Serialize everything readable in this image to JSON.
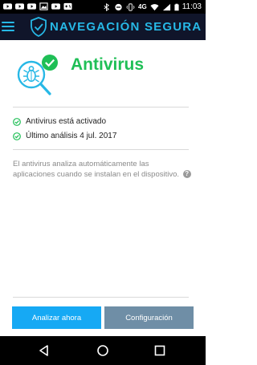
{
  "status_bar": {
    "time": "11:03",
    "network": "4G",
    "left_icons": [
      "youtube-icon",
      "youtube-icon",
      "youtube-icon",
      "image-icon",
      "youtube-icon",
      "gamepad-icon"
    ],
    "right_icons": [
      "bluetooth-icon",
      "minus-circle-icon",
      "vibrate-icon",
      "wifi-icon",
      "signal-icon",
      "battery-icon"
    ]
  },
  "header": {
    "brand_part1": "NAVEGACIÓN",
    "brand_part2": "SEGURA",
    "icons": {
      "menu": "hamburger-icon",
      "logo": "shield-check-icon"
    },
    "colors": {
      "background": "#10152a",
      "accent": "#27b8e6"
    }
  },
  "main": {
    "title": "Antivirus",
    "hero_icon": "bug-magnifier-check-icon",
    "status_items": [
      {
        "label": "Antivirus está activado",
        "icon": "check-circle-icon"
      },
      {
        "label": "Último análisis 4 jul. 2017",
        "icon": "check-circle-icon"
      }
    ],
    "description": "El antivirus analiza automáticamente las aplicaciones cuando se instalan en el dispositivo.",
    "help_glyph": "?",
    "colors": {
      "title": "#1fbf56",
      "check": "#1fbf56"
    }
  },
  "actions": {
    "primary_label": "Analizar ahora",
    "secondary_label": "Configuración",
    "colors": {
      "primary": "#16a9f4",
      "secondary": "#6f8ea6"
    }
  },
  "nav_bar": {
    "icons": [
      "back-icon",
      "home-icon",
      "recents-icon"
    ]
  }
}
